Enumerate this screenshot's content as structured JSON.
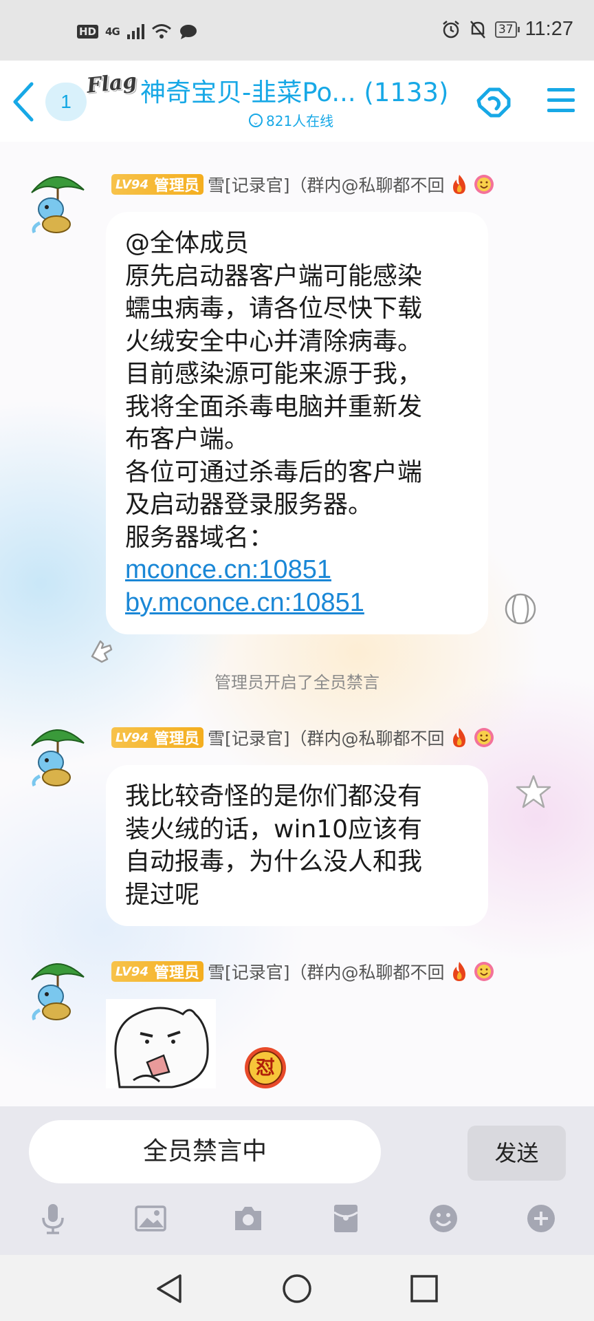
{
  "status_bar": {
    "left_indicators": [
      "HD",
      "4G"
    ],
    "battery": "37",
    "time": "11:27"
  },
  "header": {
    "unread_count": "1",
    "logo_text": "Flag",
    "title": "神奇宝贝-韭菜Po... (1133)",
    "online": "821人在线"
  },
  "colors": {
    "accent": "#17a8e6",
    "badge_gold": "#f4ae1f",
    "link": "#1a87d6"
  },
  "sender": {
    "level": "LV94",
    "role": "管理员",
    "name": "雪[记录官]（群内@私聊都不回"
  },
  "messages": [
    {
      "lines": [
        "@全体成员",
        "原先启动器客户端可能感染",
        "蠕虫病毒，请各位尽快下载",
        "火绒安全中心并清除病毒。",
        "目前感染源可能来源于我，",
        "我将全面杀毒电脑并重新发",
        "布客户端。",
        "各位可通过杀毒后的客户端",
        "及启动器登录服务器。",
        "服务器域名："
      ],
      "links": [
        "mconce.cn:10851",
        "by.mconce.cn:10851"
      ]
    },
    {
      "lines": [
        "我比较奇怪的是你们都没有",
        "装火绒的话，win10应该有",
        "自动报毒，为什么没人和我",
        "提过呢"
      ]
    }
  ],
  "system_notice": "管理员开启了全员禁言",
  "sticker_badge_text": "怼",
  "input": {
    "text": "全员禁言中",
    "send_label": "发送"
  },
  "toolbar_icons": [
    "microphone-icon",
    "image-icon",
    "camera-icon",
    "red-packet-icon",
    "emoji-icon",
    "plus-icon"
  ],
  "nav_icons": [
    "back-triangle-icon",
    "home-circle-icon",
    "recents-square-icon"
  ]
}
